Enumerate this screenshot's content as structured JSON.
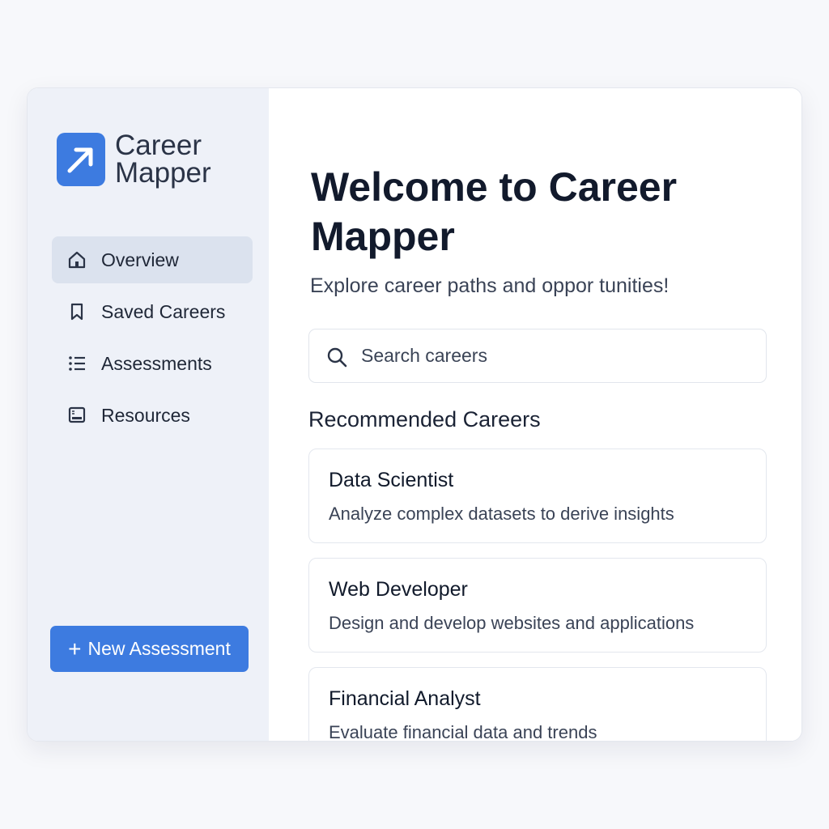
{
  "brand": {
    "name": "Career Mapper",
    "logo_icon": "arrow-up-right-icon",
    "accent_color": "#3d7be0"
  },
  "sidebar": {
    "items": [
      {
        "label": "Overview",
        "icon": "home-icon",
        "active": true
      },
      {
        "label": "Saved Careers",
        "icon": "bookmark-icon",
        "active": false
      },
      {
        "label": "Assessments",
        "icon": "list-icon",
        "active": false
      },
      {
        "label": "Resources",
        "icon": "monitor-icon",
        "active": false
      }
    ],
    "new_button": {
      "icon": "plus-icon",
      "label": "New Assessment"
    }
  },
  "main": {
    "title": "Welcome to Career Mapper",
    "subtitle": "Explore career paths and oppor tunities!",
    "search": {
      "placeholder": "Search careers",
      "value": ""
    },
    "section_title": "Recommended Careers",
    "careers": [
      {
        "title": "Data Scientist",
        "description": "Analyze complex datasets to derive insights"
      },
      {
        "title": "Web Developer",
        "description": "Design and develop websites and applications"
      },
      {
        "title": "Financial Analyst",
        "description": "Evaluate financial data and trends"
      }
    ]
  }
}
